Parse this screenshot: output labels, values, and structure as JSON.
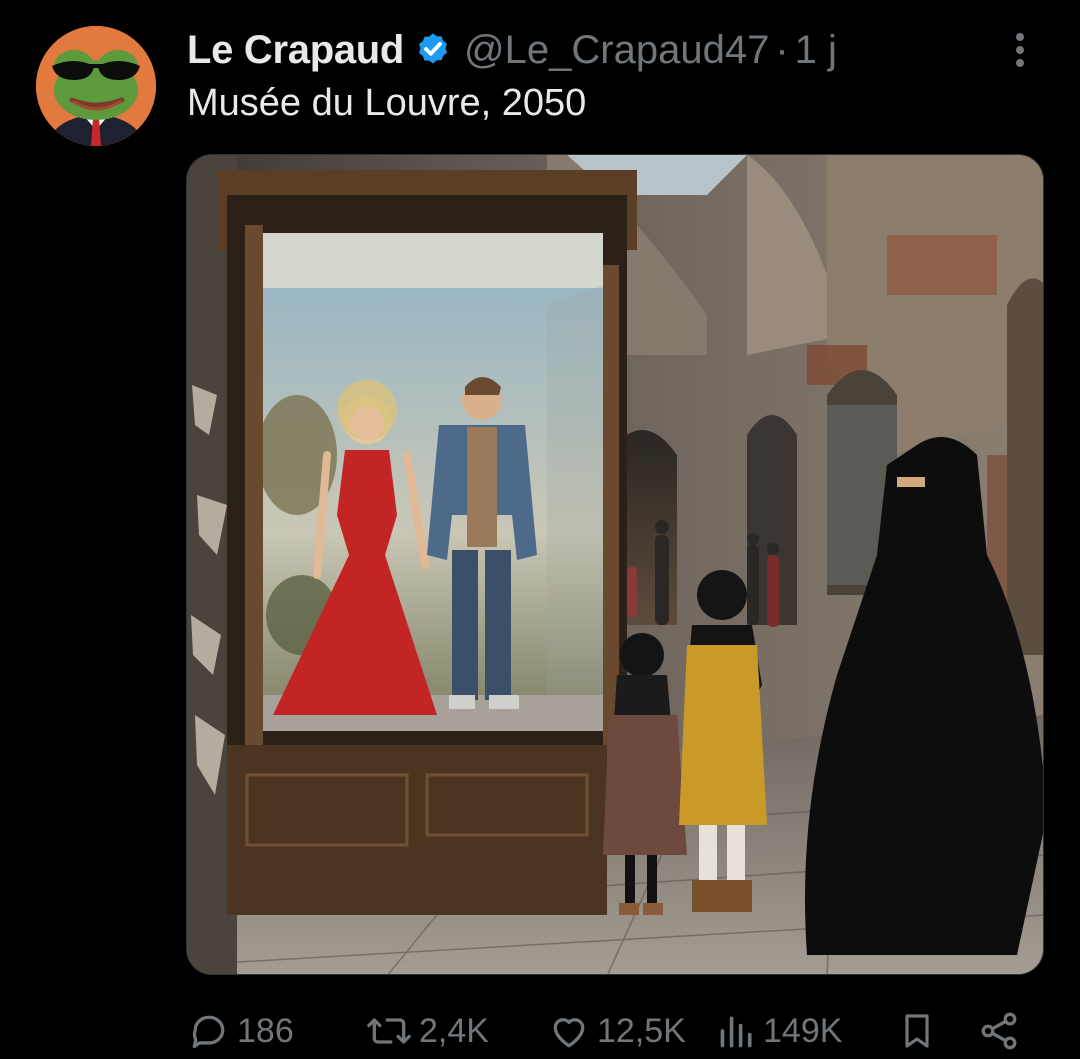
{
  "author": {
    "display_name": "Le Crapaud",
    "handle": "@Le_Crapaud47",
    "separator": "·",
    "time": "1 j",
    "verified": true,
    "avatar_icon": "frog-sunglasses-avatar"
  },
  "tweet": {
    "text": "Musée du Louvre, 2050",
    "media_description_icon": "ruined-museum-image"
  },
  "actions": {
    "replies": "186",
    "reposts": "2,4K",
    "likes": "12,5K",
    "views": "149K"
  },
  "colors": {
    "background": "#000000",
    "primary_text": "#e7e9ea",
    "secondary_text": "#71767b",
    "verified_blue": "#1d9bf0"
  }
}
